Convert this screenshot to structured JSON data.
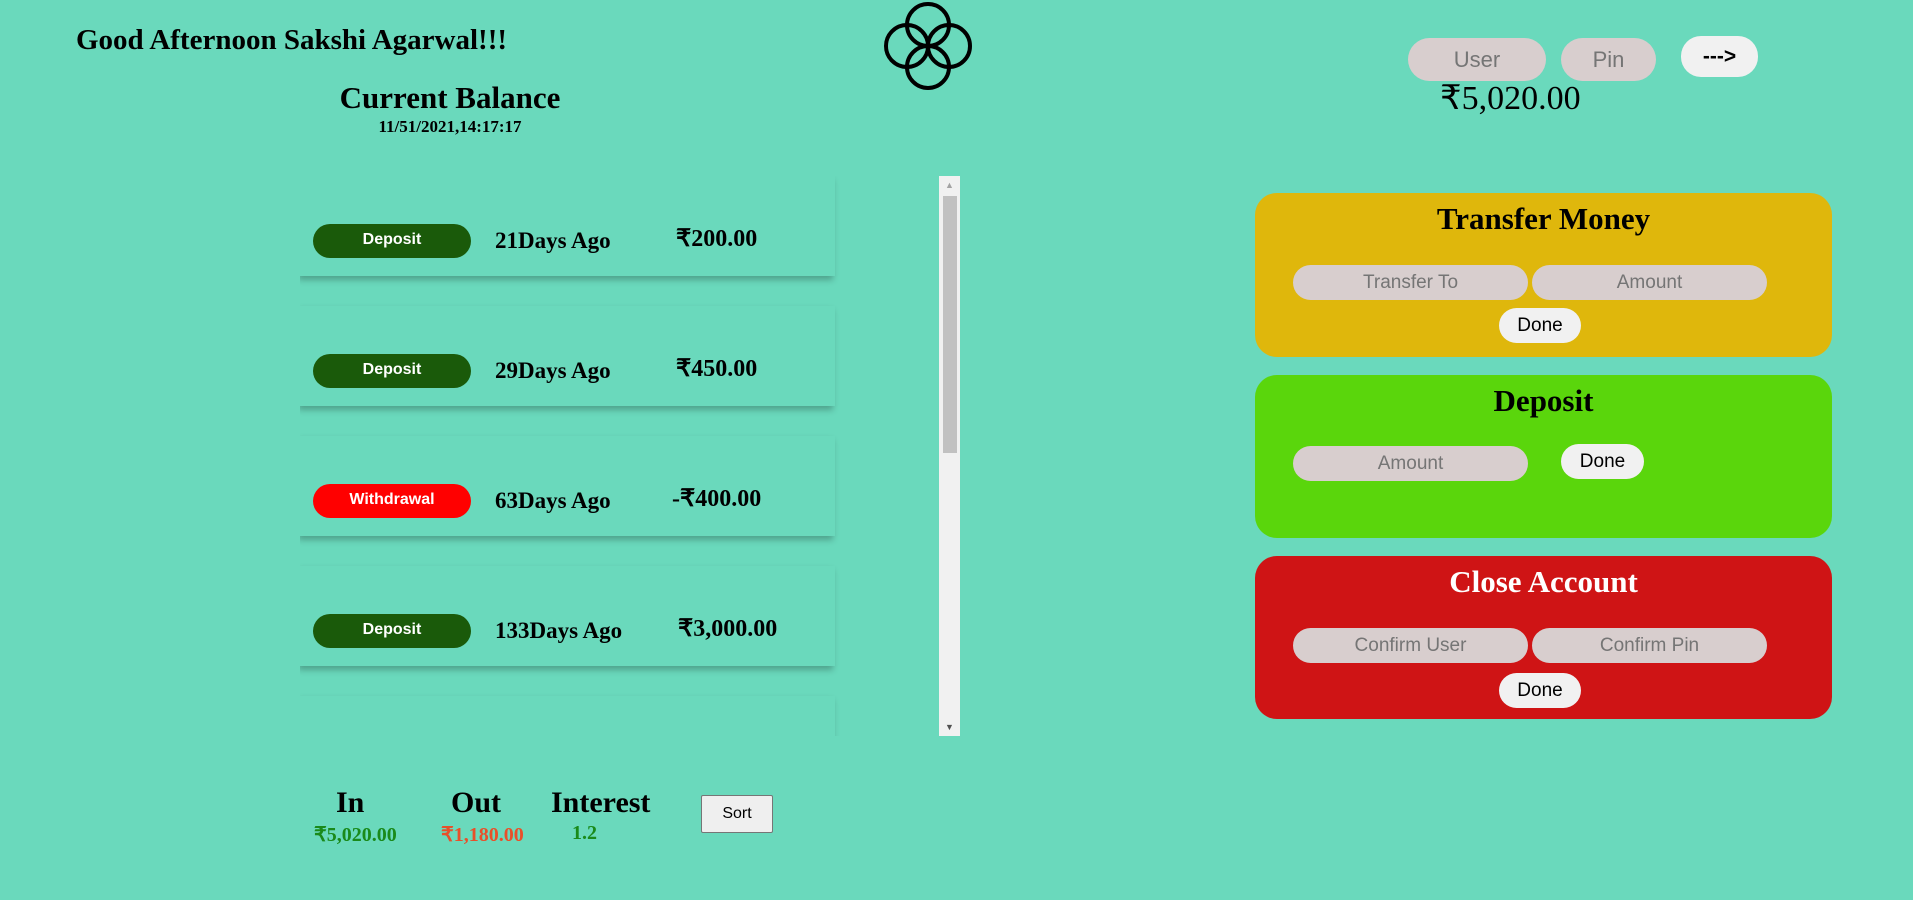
{
  "header": {
    "greeting": "Good Afternoon Sakshi Agarwal!!!",
    "login_user_placeholder": "User",
    "login_pin_placeholder": "Pin",
    "login_button_label": "--->"
  },
  "balance": {
    "title": "Current Balance",
    "date": "11/51/2021,14:17:17",
    "amount": "₹5,020.00"
  },
  "movements": [
    {
      "type": "Deposit",
      "date": "21Days Ago",
      "value": "₹200.00",
      "color": "#1a5a0a"
    },
    {
      "type": "Deposit",
      "date": "29Days Ago",
      "value": "₹450.00",
      "color": "#1a5a0a"
    },
    {
      "type": "Withdrawal",
      "date": "63Days Ago",
      "value": "-₹400.00",
      "color": "#ff0000"
    },
    {
      "type": "Deposit",
      "date": "133Days Ago",
      "value": "₹3,000.00",
      "color": "#1a5a0a"
    }
  ],
  "summary": {
    "in_label": "In",
    "in_value": "₹5,020.00",
    "out_label": "Out",
    "out_value": "₹1,180.00",
    "interest_label": "Interest",
    "interest_value": "1.2",
    "sort_label": "Sort"
  },
  "transfer": {
    "title": "Transfer Money",
    "to_placeholder": "Transfer To",
    "amount_placeholder": "Amount",
    "button_label": "Done",
    "color": "#dfb70c"
  },
  "deposit": {
    "title": "Deposit",
    "amount_placeholder": "Amount",
    "button_label": "Done",
    "color": "#5ad60c"
  },
  "close": {
    "title": "Close Account",
    "user_placeholder": "Confirm User",
    "pin_placeholder": "Confirm Pin",
    "button_label": "Done",
    "color": "#cf1415"
  },
  "colors": {
    "background": "#6ad9bc",
    "in_value": "#1a8a1a",
    "out_value": "#e8502a",
    "interest_value": "#1a8a1a"
  },
  "icons": {
    "logo": "four-circles-logo-icon"
  }
}
